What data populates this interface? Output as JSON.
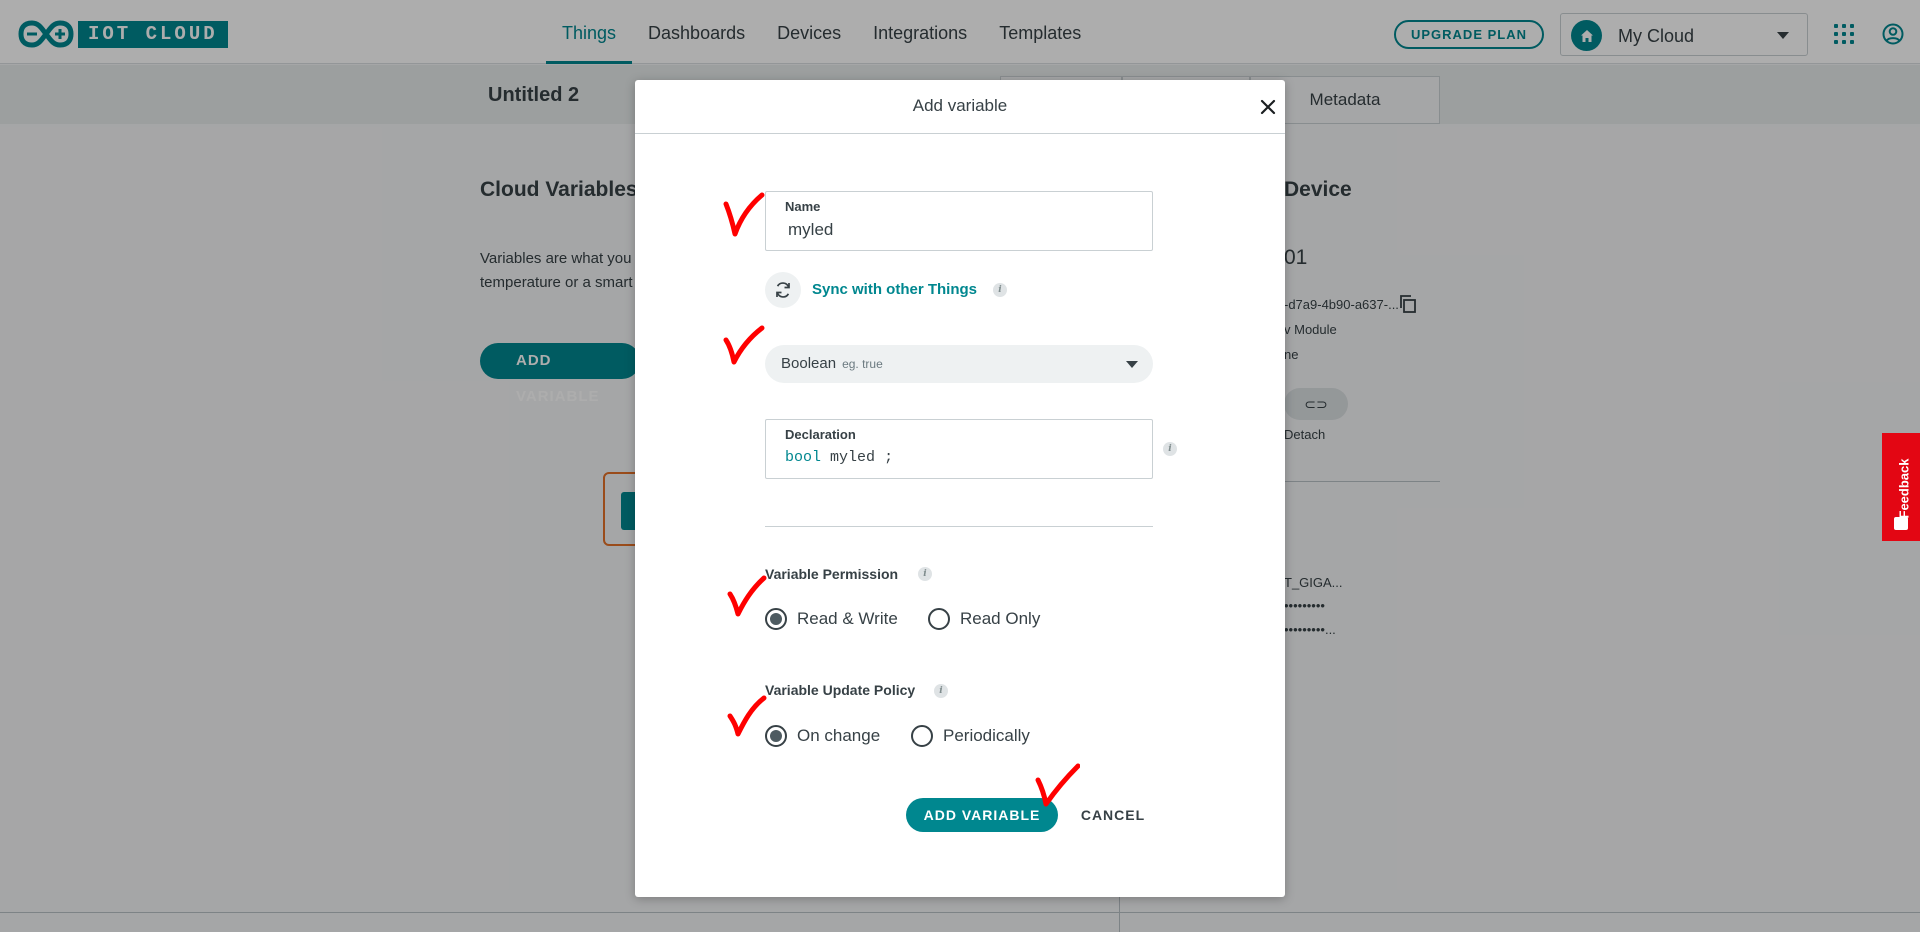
{
  "header": {
    "logo_text": "IOT CLOUD",
    "nav": [
      {
        "label": "Things",
        "active": true
      },
      {
        "label": "Dashboards",
        "active": false
      },
      {
        "label": "Devices",
        "active": false
      },
      {
        "label": "Integrations",
        "active": false
      },
      {
        "label": "Templates",
        "active": false
      }
    ],
    "upgrade_label": "UPGRADE PLAN",
    "space_label": "My Cloud"
  },
  "thing": {
    "title": "Untitled 2",
    "tabs": [
      "Metadata"
    ]
  },
  "background": {
    "cloud_variables_heading": "Cloud Variables",
    "cloud_variables_text_1": "Variables are what you",
    "cloud_variables_text_2": "temperature or a smart",
    "add_variable_label": "ADD VARIABLE",
    "device_heading": "Device",
    "device_name_fragment": "01",
    "device_id_fragment": "-d7a9-4b90-a637-...",
    "device_type_fragment": "v Module",
    "device_status_fragment": "ne",
    "detach_label": "Detach",
    "network_ssid_fragment": "T_GIGA...",
    "network_pass_1": "•••••••••",
    "network_pass_2": "•••••••••..."
  },
  "feedback_label": "Feedback",
  "modal": {
    "title": "Add variable",
    "name_label": "Name",
    "name_value": "myled",
    "sync_label": "Sync with other Things",
    "type_value": "Boolean",
    "type_hint": "eg. true",
    "declaration_label": "Declaration",
    "declaration_keyword": "bool",
    "declaration_name": "myled",
    "declaration_end": ";",
    "permission_label": "Variable Permission",
    "permission_options": [
      "Read & Write",
      "Read Only"
    ],
    "permission_selected": "Read & Write",
    "policy_label": "Variable Update Policy",
    "policy_options": [
      "On change",
      "Periodically"
    ],
    "policy_selected": "On change",
    "add_button_label": "ADD VARIABLE",
    "cancel_button_label": "CANCEL",
    "info_glyph": "i"
  },
  "colors": {
    "accent": "#00878f",
    "annotation": "#ff0000",
    "feedback": "#e30613"
  }
}
